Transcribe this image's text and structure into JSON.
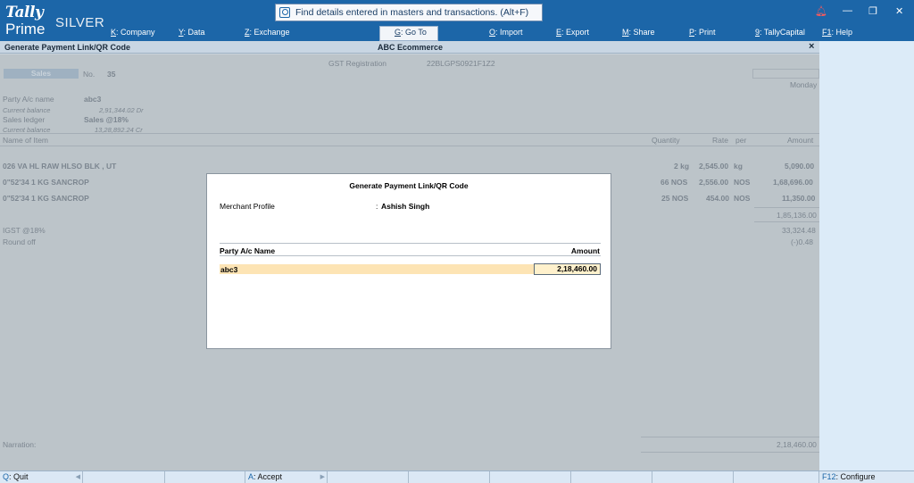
{
  "app": {
    "logo_tally": "Tally",
    "logo_prime": "Prime",
    "edition": "SILVER",
    "search_placeholder": "Find details entered in masters and transactions. (Alt+F)"
  },
  "menu": [
    {
      "key": "K",
      "label": ": Company"
    },
    {
      "key": "Y",
      "label": ": Data"
    },
    {
      "key": "Z",
      "label": ": Exchange"
    },
    {
      "key": "G",
      "label": ": Go To"
    },
    {
      "key": "O",
      "label": ": Import"
    },
    {
      "key": "E",
      "label": ": Export"
    },
    {
      "key": "M",
      "label": ": Share"
    },
    {
      "key": "P",
      "label": ": Print"
    },
    {
      "key": "9",
      "label": ": TallyCapital"
    },
    {
      "key": "F1",
      "label": ": Help"
    }
  ],
  "titlebar": {
    "left": "Generate Payment Link/QR Code",
    "center": "ABC  Ecommerce",
    "close": "×"
  },
  "voucher": {
    "gst_reg_label": "GST Registration",
    "gst_reg_value": "22BLGPS0921F1Z2",
    "type": "Sales",
    "no_label": "No.",
    "no_value": "35",
    "day": "Monday",
    "party_label": "Party A/c name",
    "party_value": "abc3",
    "party_bal_label": "Current balance",
    "party_bal_value": "2,91,344.02 Dr",
    "ledger_label": "Sales ledger",
    "ledger_value": "Sales @18%",
    "ledger_bal_label": "Current balance",
    "ledger_bal_value": "13,28,892.24 Cr",
    "col_item": "Name of Item",
    "col_qty": "Quantity",
    "col_rate": "Rate",
    "col_per": "per",
    "col_amount": "Amount",
    "items": [
      {
        "name": "026 VA HL RAW HLSO BLK , UT",
        "qty": "2 kg",
        "rate": "2,545.00",
        "per": "kg",
        "amount": "5,090.00"
      },
      {
        "name": "0\"52'34 1 KG SANCROP",
        "qty": "66 NOS",
        "rate": "2,556.00",
        "per": "NOS",
        "amount": "1,68,696.00"
      },
      {
        "name": "0\"52'34 1 KG SANCROP",
        "qty": "25 NOS",
        "rate": "454.00",
        "per": "NOS",
        "amount": "11,350.00"
      }
    ],
    "subtotal": "1,85,136.00",
    "igst_label": "IGST @18%",
    "igst_value": "33,324.48",
    "roundoff_label": "Round off",
    "roundoff_value": "(-)0.48",
    "narration_label": "Narration:",
    "total": "2,18,460.00"
  },
  "modal": {
    "title": "Generate Payment Link/QR Code",
    "merchant_label": "Merchant Profile",
    "merchant_sep": ":",
    "merchant_value": "Ashish Singh",
    "col_party": "Party A/c Name",
    "col_amount": "Amount",
    "row_party": "abc3",
    "row_amount": "2,18,460.00"
  },
  "bottombar": {
    "quit_key": "Q",
    "quit_label": ": Quit",
    "accept_key": "A",
    "accept_label": ": Accept",
    "configure_key": "F12",
    "configure_label": ": Configure"
  },
  "colors": {
    "header_bg": "#1c66a8",
    "modal_highlight": "#fde4b4",
    "side_pane": "#dcebf8"
  }
}
